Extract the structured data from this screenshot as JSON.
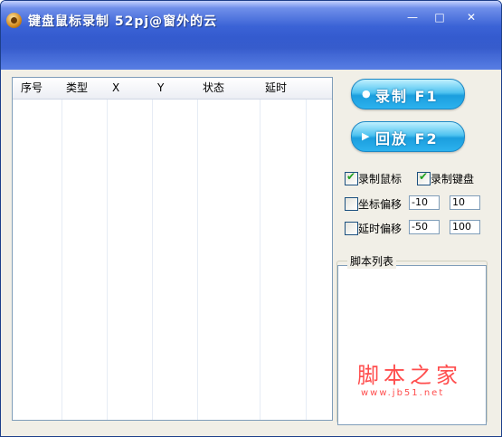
{
  "window": {
    "title": "键盘鼠标录制  52pj@窗外的云",
    "minimize": "—",
    "maximize": "□",
    "close": "✕"
  },
  "listview": {
    "columns": [
      "序号",
      "类型",
      "X",
      "Y",
      "状态",
      "延时"
    ]
  },
  "buttons": {
    "record": {
      "icon": "record-dot-icon",
      "label": "录制 F1"
    },
    "play": {
      "icon": "play-triangle-icon",
      "label": "回放 F2"
    }
  },
  "options": {
    "record_mouse": {
      "label": "录制鼠标",
      "checked": true
    },
    "record_keyboard": {
      "label": "录制键盘",
      "checked": true
    },
    "coord_offset": {
      "label": "坐标偏移",
      "checked": false,
      "min": "-10",
      "max": "10"
    },
    "delay_offset": {
      "label": "延时偏移",
      "checked": false,
      "min": "-50",
      "max": "100"
    }
  },
  "script_list": {
    "title": "脚本列表"
  },
  "watermark": {
    "text": "脚本之家",
    "url": "www.jb51.net"
  },
  "colors": {
    "titlebar": "#3b63d6",
    "button_blue": "#1b9ede",
    "watermark": "#ff4d4d"
  }
}
